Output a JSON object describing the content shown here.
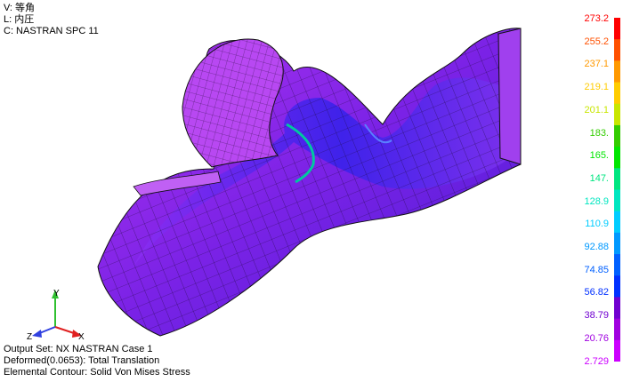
{
  "header": {
    "view_line": "V: 等角",
    "load_line": "L: 内圧",
    "constraint_line": "C: NASTRAN SPC 11"
  },
  "footer": {
    "output_set": "Output Set: NX NASTRAN Case 1",
    "deformed": "Deformed(0.0653): Total Translation",
    "contour": "Elemental Contour: Solid Von Mises Stress"
  },
  "triad": {
    "x": "X",
    "y": "Y",
    "z": "Z"
  },
  "legend": {
    "labels": [
      "273.2",
      "255.2",
      "237.1",
      "219.1",
      "201.1",
      "183.",
      "165.",
      "147.",
      "128.9",
      "110.9",
      "92.88",
      "74.85",
      "56.82",
      "38.79",
      "20.76",
      "2.729"
    ],
    "colors": [
      "#ff0000",
      "#ff5000",
      "#ff9900",
      "#ffcc00",
      "#c8e600",
      "#33cc00",
      "#00e600",
      "#00e680",
      "#00e6c0",
      "#00ccff",
      "#0099ff",
      "#0060ff",
      "#0030ff",
      "#7000d0",
      "#a000e0",
      "#cc00ff"
    ]
  }
}
